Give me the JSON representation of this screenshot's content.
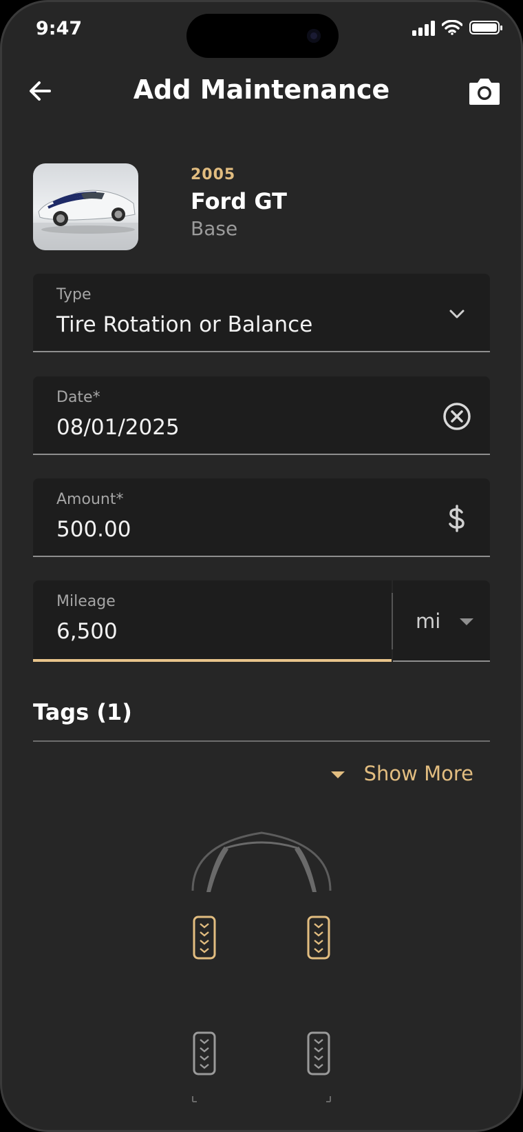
{
  "status_bar": {
    "time": "9:47"
  },
  "header": {
    "title": "Add Maintenance"
  },
  "vehicle": {
    "year": "2005",
    "model": "Ford GT",
    "trim": "Base"
  },
  "form": {
    "type": {
      "label": "Type",
      "value": "Tire Rotation or Balance"
    },
    "date": {
      "label": "Date*",
      "value": "08/01/2025"
    },
    "amount": {
      "label": "Amount*",
      "value": "500.00"
    },
    "mileage": {
      "label": "Mileage",
      "value": "6,500",
      "unit": "mi"
    }
  },
  "tags": {
    "title": "Tags (1)"
  },
  "show_more": {
    "label": "Show More"
  },
  "tire_diagram": {
    "tires": [
      {
        "position": "front-left",
        "selected": true
      },
      {
        "position": "front-right",
        "selected": true
      },
      {
        "position": "rear-left",
        "selected": false
      },
      {
        "position": "rear-right",
        "selected": false
      }
    ]
  },
  "colors": {
    "accent": "#e2bd80",
    "background": "#262626",
    "field_background": "#1d1d1d",
    "text_primary": "#ffffff",
    "text_secondary": "#a6a6a6"
  },
  "icons": [
    "arrow-left-icon",
    "camera-icon",
    "chevron-down-icon",
    "clear-circle-icon",
    "dollar-icon",
    "caret-down-icon",
    "car-front-icon",
    "tire-icon"
  ]
}
